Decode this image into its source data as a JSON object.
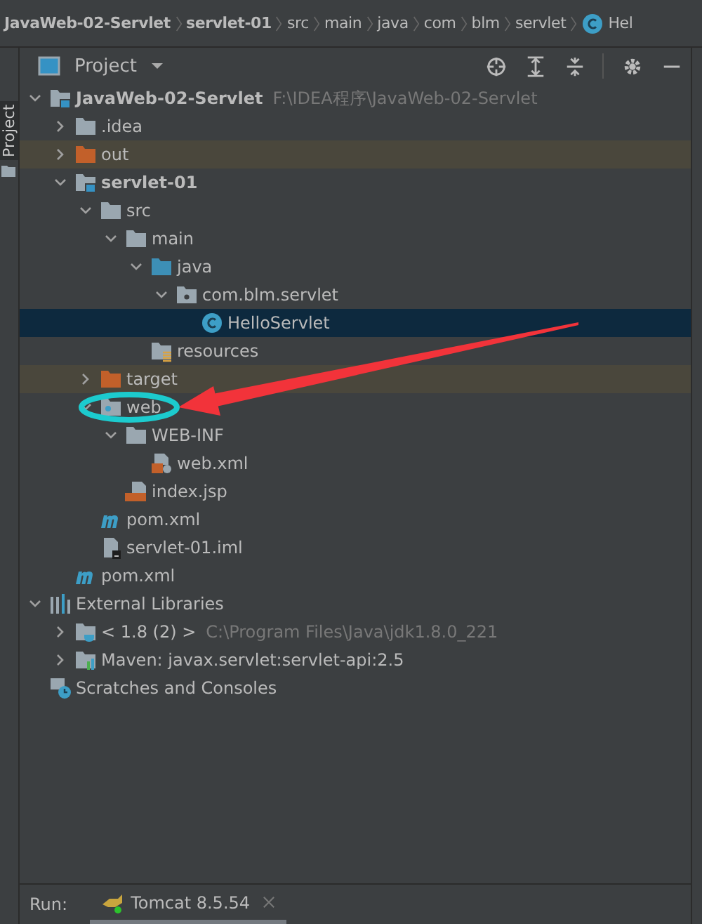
{
  "breadcrumbs": [
    {
      "label": "JavaWeb-02-Servlet",
      "kind": "module"
    },
    {
      "label": "servlet-01",
      "kind": "module"
    },
    {
      "label": "src",
      "kind": "folder"
    },
    {
      "label": "main",
      "kind": "folder"
    },
    {
      "label": "java",
      "kind": "folder"
    },
    {
      "label": "com",
      "kind": "folder"
    },
    {
      "label": "blm",
      "kind": "folder"
    },
    {
      "label": "servlet",
      "kind": "folder"
    },
    {
      "label": "Hel",
      "kind": "class"
    }
  ],
  "tool_window": {
    "stripe_label": "Project",
    "title": "Project"
  },
  "tree": [
    {
      "label": "JavaWeb-02-Servlet",
      "kind": "module",
      "expanded": true,
      "selected": false,
      "excluded": false,
      "hint": "F:\\IDEA程序\\JavaWeb-02-Servlet",
      "children": [
        {
          "label": ".idea",
          "kind": "folder",
          "expanded": false,
          "selected": false,
          "excluded": false
        },
        {
          "label": "out",
          "kind": "folder",
          "expanded": false,
          "selected": false,
          "excluded": true
        },
        {
          "label": "servlet-01",
          "kind": "module",
          "expanded": true,
          "selected": false,
          "excluded": false,
          "children": [
            {
              "label": "src",
              "kind": "folder",
              "expanded": true,
              "selected": false,
              "excluded": false,
              "children": [
                {
                  "label": "main",
                  "kind": "folder",
                  "expanded": true,
                  "selected": false,
                  "excluded": false,
                  "children": [
                    {
                      "label": "java",
                      "kind": "source",
                      "expanded": true,
                      "selected": false,
                      "excluded": false,
                      "children": [
                        {
                          "label": "com.blm.servlet",
                          "kind": "package",
                          "expanded": true,
                          "selected": false,
                          "excluded": false,
                          "children": [
                            {
                              "label": "HelloServlet",
                              "kind": "class",
                              "selected": true,
                              "excluded": false
                            }
                          ]
                        }
                      ]
                    },
                    {
                      "label": "resources",
                      "kind": "resources",
                      "selected": false,
                      "excluded": false
                    }
                  ]
                }
              ]
            },
            {
              "label": "target",
              "kind": "folder",
              "expanded": false,
              "selected": false,
              "excluded": true
            },
            {
              "label": "web",
              "kind": "web",
              "expanded": true,
              "selected": false,
              "excluded": false,
              "children": [
                {
                  "label": "WEB-INF",
                  "kind": "folder",
                  "expanded": true,
                  "selected": false,
                  "excluded": false,
                  "children": [
                    {
                      "label": "web.xml",
                      "kind": "xml",
                      "selected": false,
                      "excluded": false
                    }
                  ]
                },
                {
                  "label": "index.jsp",
                  "kind": "jsp",
                  "selected": false,
                  "excluded": false
                }
              ]
            },
            {
              "label": "pom.xml",
              "kind": "maven",
              "selected": false,
              "excluded": false
            },
            {
              "label": "servlet-01.iml",
              "kind": "iml",
              "selected": false,
              "excluded": false
            }
          ]
        },
        {
          "label": "pom.xml",
          "kind": "maven",
          "selected": false,
          "excluded": false
        }
      ]
    },
    {
      "label": "External Libraries",
      "kind": "libraries",
      "expanded": true,
      "selected": false,
      "excluded": false,
      "children": [
        {
          "label": "< 1.8 (2) >",
          "kind": "jdk",
          "expanded": false,
          "selected": false,
          "excluded": false,
          "hint": "C:\\Program Files\\Java\\jdk1.8.0_221"
        },
        {
          "label": "Maven: javax.servlet:servlet-api:2.5",
          "kind": "library",
          "expanded": false,
          "selected": false,
          "excluded": false
        }
      ]
    },
    {
      "label": "Scratches and Consoles",
      "kind": "scratches",
      "selected": false,
      "excluded": false
    }
  ],
  "run_bar": {
    "label": "Run:",
    "tabs": [
      {
        "label": "Tomcat 8.5.54",
        "selected": true
      }
    ]
  }
}
